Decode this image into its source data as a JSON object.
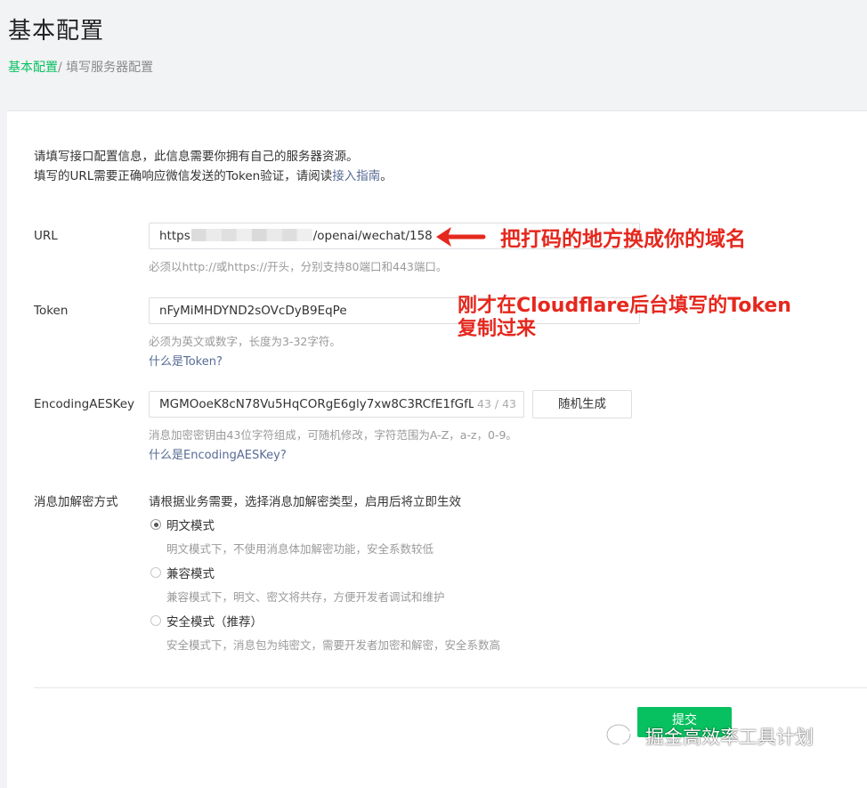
{
  "header": {
    "title": "基本配置",
    "breadcrumb_link": "基本配置",
    "breadcrumb_sep": "/ ",
    "breadcrumb_current": "填写服务器配置"
  },
  "intro": {
    "line1": "请填写接口配置信息，此信息需要你拥有自己的服务器资源。",
    "line2_prefix": "填写的URL需要正确响应微信发送的Token验证，请阅读",
    "guide_link": "接入指南",
    "line2_suffix": "。"
  },
  "url": {
    "label": "URL",
    "value_prefix": "https",
    "value_suffix": "/openai/wechat/158",
    "hint": "必须以http://或https://开头，分别支持80端口和443端口。"
  },
  "token": {
    "label": "Token",
    "value": "nFyMiMHDYND2sOVcDyB9EqPe",
    "hint": "必须为英文或数字，长度为3-32字符。",
    "help_link": "什么是Token?"
  },
  "aes": {
    "label": "EncodingAESKey",
    "value": "MGMOoeK8cN78Vu5HqCORgE6gly7xw8C3RCfE1fGfL",
    "counter": "43 / 43",
    "random_button": "随机生成",
    "hint": "消息加密密钥由43位字符组成，可随机修改，字符范围为A-Z，a-z，0-9。",
    "help_link": "什么是EncodingAESKey?"
  },
  "encryption": {
    "label": "消息加解密方式",
    "intro": "请根据业务需要，选择消息加解密类型，启用后将立即生效",
    "options": [
      {
        "label": "明文模式",
        "desc": "明文模式下，不使用消息体加解密功能，安全系数较低",
        "checked": true
      },
      {
        "label": "兼容模式",
        "desc": "兼容模式下，明文、密文将共存，方便开发者调试和维护",
        "checked": false
      },
      {
        "label": "安全模式（推荐）",
        "desc": "安全模式下，消息包为纯密文，需要开发者加密和解密，安全系数高",
        "checked": false
      }
    ]
  },
  "submit_button": "提交",
  "annotations": {
    "domain_note": "把打码的地方换成你的域名",
    "token_note_line1": "刚才在Cloudflare后台填写的Token",
    "token_note_line2": "复制过来",
    "color": "#e5281e"
  },
  "watermark": {
    "text": "掘金高效率工具计划"
  },
  "colors": {
    "accent_green": "#07c160",
    "link_blue": "#576b95"
  }
}
